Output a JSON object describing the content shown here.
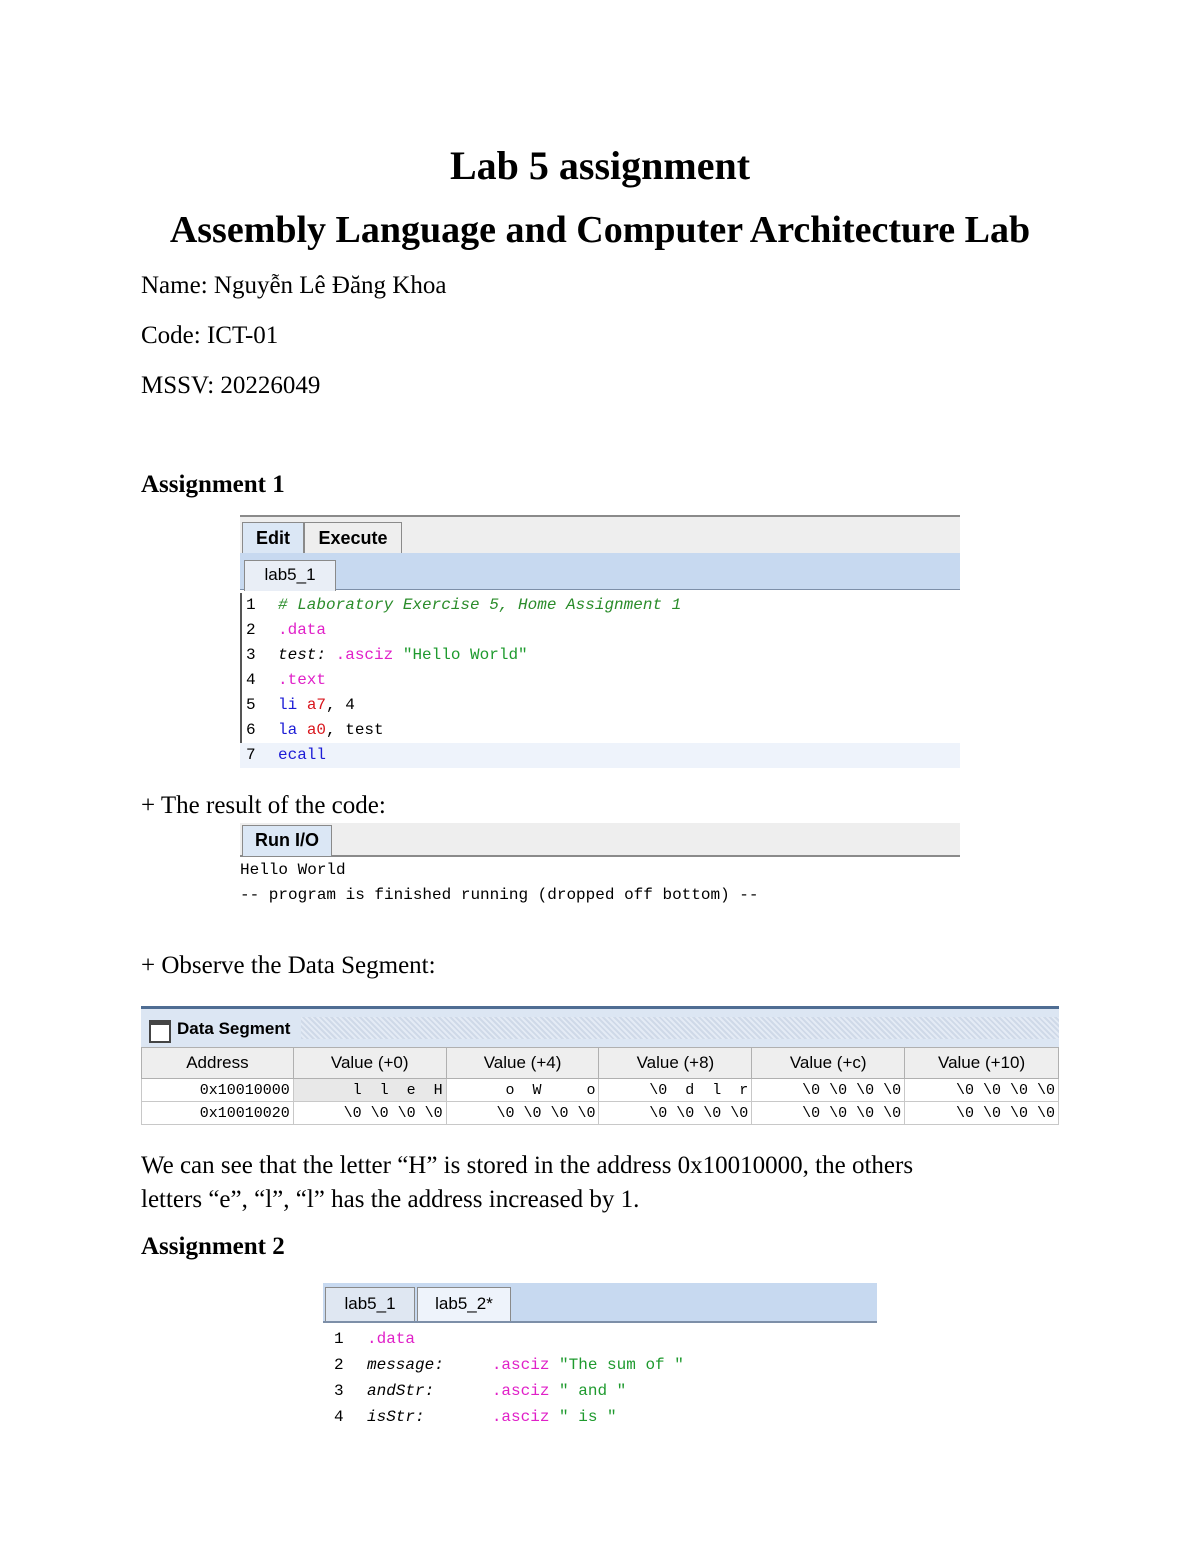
{
  "document": {
    "title": "Lab 5 assignment",
    "subtitle": "Assembly Language and Computer Architecture Lab",
    "name_line": "Name: Nguyễn Lê Đăng Khoa",
    "code_line": "Code: ICT-01",
    "mssv_line": "MSSV: 20226049",
    "assignment1_heading": "Assignment 1",
    "result_caption": "+ The result of the code:",
    "observe_caption": "+ Observe the Data Segment:",
    "explanation_line1": "We can see that the letter “H” is stored in the address 0x10010000, the others",
    "explanation_line2": "letters “e”, “l”, “l” has the address increased by 1.",
    "assignment2_heading": "Assignment 2"
  },
  "editor1": {
    "tabs": [
      "Edit",
      "Execute"
    ],
    "file_tab": "lab5_1",
    "lines": [
      {
        "num": "1",
        "parts": [
          {
            "t": "# Laboratory Exercise 5, Home Assignment 1",
            "c": "cmt"
          }
        ]
      },
      {
        "num": "2",
        "parts": [
          {
            "t": ".data",
            "c": "dir"
          }
        ]
      },
      {
        "num": "3",
        "parts": [
          {
            "t": "test:",
            "c": "lbl"
          },
          {
            "t": " ",
            "c": ""
          },
          {
            "t": ".asciz",
            "c": "dir"
          },
          {
            "t": " \"Hello World\"",
            "c": "str"
          }
        ]
      },
      {
        "num": "4",
        "parts": [
          {
            "t": ".text",
            "c": "dir"
          }
        ]
      },
      {
        "num": "5",
        "parts": [
          {
            "t": "li",
            "c": "kw"
          },
          {
            "t": " ",
            "c": ""
          },
          {
            "t": "a7",
            "c": "reg"
          },
          {
            "t": ", 4",
            "c": ""
          }
        ]
      },
      {
        "num": "6",
        "parts": [
          {
            "t": "la",
            "c": "kw"
          },
          {
            "t": " ",
            "c": ""
          },
          {
            "t": "a0",
            "c": "reg"
          },
          {
            "t": ", test",
            "c": ""
          }
        ]
      },
      {
        "num": "7",
        "parts": [
          {
            "t": "ecall",
            "c": "kw"
          }
        ],
        "highlight": true
      }
    ]
  },
  "run_io": {
    "tab": "Run I/O",
    "output_line1": "Hello World",
    "output_line2": "-- program is finished running (dropped off bottom) --"
  },
  "data_segment": {
    "title": "Data Segment",
    "headers": [
      "Address",
      "Value (+0)",
      "Value (+4)",
      "Value (+8)",
      "Value (+c)",
      "Value (+10)"
    ],
    "rows": [
      [
        "0x10010000",
        "  l  l  e  H",
        "  o  W     o",
        " \\0  d  l  r",
        "\\0 \\0 \\0 \\0",
        "\\0 \\0 \\0 \\0"
      ],
      [
        "0x10010020",
        "\\0 \\0 \\0 \\0",
        "\\0 \\0 \\0 \\0",
        "\\0 \\0 \\0 \\0",
        "\\0 \\0 \\0 \\0",
        "\\0 \\0 \\0 \\0"
      ]
    ]
  },
  "editor2": {
    "file_tabs": [
      "lab5_1",
      "lab5_2*"
    ],
    "lines": [
      {
        "num": "1",
        "parts": [
          {
            "t": ".data",
            "c": "dir"
          }
        ]
      },
      {
        "num": "2",
        "parts": [
          {
            "t": "message:",
            "c": "lbl"
          },
          {
            "t": "     ",
            "c": ""
          },
          {
            "t": ".asciz",
            "c": "dir"
          },
          {
            "t": " \"The sum of \"",
            "c": "str"
          }
        ]
      },
      {
        "num": "3",
        "parts": [
          {
            "t": "andStr:",
            "c": "lbl"
          },
          {
            "t": "      ",
            "c": ""
          },
          {
            "t": ".asciz",
            "c": "dir"
          },
          {
            "t": " \" and \"",
            "c": "str"
          }
        ]
      },
      {
        "num": "4",
        "parts": [
          {
            "t": "isStr:",
            "c": "lbl"
          },
          {
            "t": "       ",
            "c": ""
          },
          {
            "t": ".asciz",
            "c": "dir"
          },
          {
            "t": " \" is \"",
            "c": "str"
          }
        ]
      }
    ]
  }
}
